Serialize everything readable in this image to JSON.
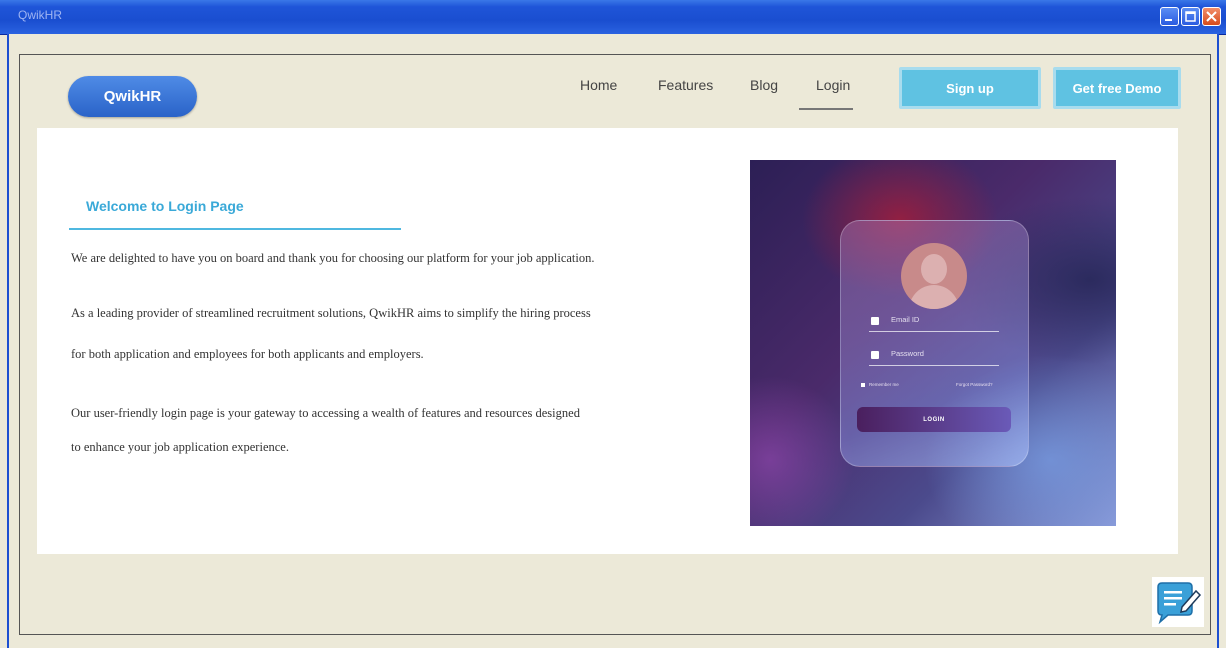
{
  "window": {
    "title": "QwikHR",
    "controls": [
      "minimize-icon",
      "maximize-icon",
      "close-icon"
    ]
  },
  "header": {
    "logo": "QwikHR",
    "nav": [
      {
        "label": "Home",
        "active": false
      },
      {
        "label": "Features",
        "active": false
      },
      {
        "label": "Blog",
        "active": false
      },
      {
        "label": "Login",
        "active": true
      }
    ],
    "signup_label": "Sign up",
    "demo_label": "Get free Demo"
  },
  "main": {
    "heading": "Welcome to Login Page",
    "paragraphs": [
      "We are delighted to have you on board and thank you for choosing our platform for your job application.",
      "As a leading provider of streamlined recruitment solutions, QwikHR aims to simplify the hiring process",
      "for both application and employees for both applicants and employers.",
      "Our user-friendly login page is your gateway to accessing a wealth of features and resources designed",
      "to enhance your job application experience."
    ]
  },
  "illustration": {
    "email_placeholder": "Email ID",
    "password_placeholder": "Password",
    "remember": "Remember me",
    "forgot": "Forgot Password?",
    "login_button": "LOGIN"
  },
  "colors": {
    "accent": "#5fc2e2",
    "heading": "#3aa9d8",
    "logo": "#3b76d8"
  },
  "chat_widget": {
    "icon": "chat-edit-icon"
  }
}
